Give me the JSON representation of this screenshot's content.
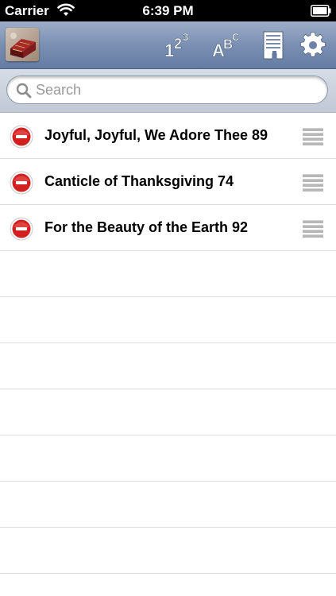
{
  "status_bar": {
    "carrier": "Carrier",
    "time": "6:39 PM",
    "wifi_icon": "wifi-icon",
    "battery_icon": "battery-icon"
  },
  "toolbar": {
    "app_logo_icon": "hymnal-book-icon",
    "sort_numeric_icon": "sort-numeric-icon",
    "sort_alpha_icon": "sort-alphabetical-icon",
    "bookmark_icon": "bookmark-list-icon",
    "settings_icon": "gear-icon",
    "sort_numeric_glyph": {
      "base": "1",
      "mid": "2",
      "top": "3"
    },
    "sort_alpha_glyph": {
      "base": "A",
      "mid": "B",
      "top": "C"
    }
  },
  "search": {
    "placeholder": "Search",
    "value": ""
  },
  "list": {
    "items": [
      {
        "title": "Joyful, Joyful, We Adore Thee 89"
      },
      {
        "title": "Canticle of Thanksgiving 74"
      },
      {
        "title": "For the Beauty of the Earth 92"
      }
    ],
    "delete_icon": "delete-minus-icon",
    "reorder_icon": "reorder-handle-icon"
  },
  "colors": {
    "nav_bar": "#7a8fb2",
    "delete_red": "#d21f1f",
    "status_bar": "#000000"
  }
}
